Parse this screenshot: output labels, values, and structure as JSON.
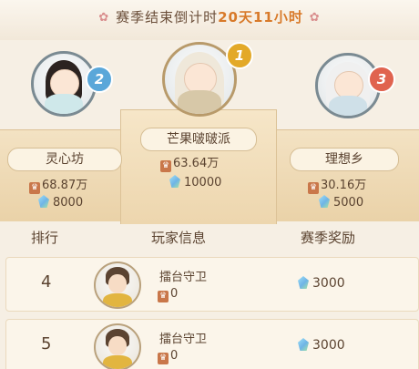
{
  "header": {
    "countdown_label": "赛季结束倒计时",
    "countdown_time": "20天11小时"
  },
  "podium": [
    {
      "rank": "2",
      "name": "灵心坊",
      "score": "68.87万",
      "gems": "8000"
    },
    {
      "rank": "1",
      "name": "芒果啵啵派",
      "score": "63.64万",
      "gems": "10000"
    },
    {
      "rank": "3",
      "name": "理想乡",
      "score": "30.16万",
      "gems": "5000"
    }
  ],
  "table": {
    "headers": {
      "rank": "排行",
      "player": "玩家信息",
      "reward": "赛季奖励"
    },
    "rows": [
      {
        "rank": "4",
        "name": "擂台守卫",
        "score": "0",
        "reward": "3000"
      },
      {
        "rank": "5",
        "name": "擂台守卫",
        "score": "0",
        "reward": "3000"
      }
    ]
  },
  "colors": {
    "accent": "#d87a2a",
    "rank1": "#e3a928",
    "rank2": "#5aa7d9",
    "rank3": "#e0634f"
  }
}
